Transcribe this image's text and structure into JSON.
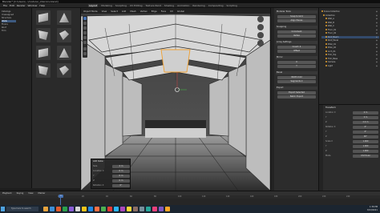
{
  "window": {
    "title": "Blender* [C:\\Users\\...\\modular_interiors.blend]"
  },
  "topbar": {
    "menus": [
      "File",
      "Edit",
      "Render",
      "Window",
      "Help"
    ],
    "tabs": [
      "Layout",
      "Modeling",
      "Sculpting",
      "UV Editing",
      "Texture Paint",
      "Shading",
      "Animation",
      "Rendering",
      "Compositing",
      "Scripting"
    ],
    "active_tab": "Layout"
  },
  "left_tree": {
    "items": [
      "Catalogs",
      "Unassigned",
      "Structure",
      "Walls",
      "Floors",
      "Roof",
      "Trim"
    ],
    "selected_index": 3
  },
  "assets": {
    "count": 8
  },
  "viewport": {
    "header_items": [
      "Object Mode",
      "View",
      "Select",
      "Add",
      "Mesh",
      "Vertex",
      "Edge",
      "Face",
      "UV",
      "Global"
    ],
    "operator_panel": {
      "title": "Add Cube",
      "rows": [
        {
          "label": "Size",
          "value": "2 m"
        },
        {
          "label": "Location X",
          "value": "0 m"
        },
        {
          "label": "Y",
          "value": "0 m"
        },
        {
          "label": "Z",
          "value": "0 m"
        },
        {
          "label": "Rotation X",
          "value": "0°"
        }
      ]
    }
  },
  "npanel": {
    "sections": [
      {
        "title": "Modular Tools",
        "buttons": [
          "Snap to Grid",
          "Align Pieces"
        ]
      },
      {
        "title": "Snapping",
        "buttons": [
          "Increment",
          "Vertex"
        ]
      },
      {
        "title": "Array Settings",
        "buttons": [
          "Count: 4",
          "Offset"
        ]
      },
      {
        "title": "Mirror",
        "buttons": [
          "X",
          "Y"
        ]
      },
      {
        "title": "Bevel",
        "buttons": [
          "Width 0.02",
          "Segments 2"
        ]
      },
      {
        "title": "Export",
        "buttons": [
          "Export Selected",
          "Batch Export"
        ]
      }
    ]
  },
  "outliner": {
    "items": [
      "Scene Collection",
      "Collection",
      "Wall_A",
      "Wall_B",
      "Wall_C",
      "Floor_01",
      "Floor_02",
      "Roof_Beam",
      "Roof_Panel",
      "Pillar_01",
      "Pillar_02",
      "Arch_01",
      "Trim_Top",
      "Trim_Base",
      "Camera",
      "Light"
    ],
    "selected_index": 7
  },
  "properties": {
    "section": "Transform",
    "rows": [
      {
        "label": "Location X",
        "value": "0 m"
      },
      {
        "label": "Y",
        "value": "0 m"
      },
      {
        "label": "Z",
        "value": "2.4 m"
      },
      {
        "label": "Rotation X",
        "value": "0°"
      },
      {
        "label": "Y",
        "value": "0°"
      },
      {
        "label": "Z",
        "value": "90°"
      },
      {
        "label": "Scale X",
        "value": "1.000"
      },
      {
        "label": "Y",
        "value": "1.000"
      },
      {
        "label": "Z",
        "value": "1.000"
      },
      {
        "label": "Mode",
        "value": "XYZ Euler"
      }
    ]
  },
  "timeline": {
    "header": [
      "Playback",
      "Keying",
      "View",
      "Marker"
    ],
    "current_frame": "1",
    "ticks": [
      "0",
      "20",
      "40",
      "60",
      "80",
      "100",
      "120",
      "140",
      "160",
      "180",
      "200",
      "220",
      "240"
    ]
  },
  "taskbar": {
    "search_placeholder": "Type here to search",
    "time": "1:36 PM",
    "date": "8/13/2021",
    "app_colors": [
      "#e8a33d",
      "#3c8fd6",
      "#e05a2b",
      "#2aa14b",
      "#8b5cd6",
      "#d6d6d6",
      "#f0c419",
      "#1e88e5",
      "#ff7043",
      "#4caf50",
      "#e53935",
      "#29b6f6",
      "#ab47bc",
      "#fdd835",
      "#8d6e63",
      "#78909c",
      "#26a69a",
      "#ec407a",
      "#7e57c2",
      "#ffa726"
    ]
  }
}
